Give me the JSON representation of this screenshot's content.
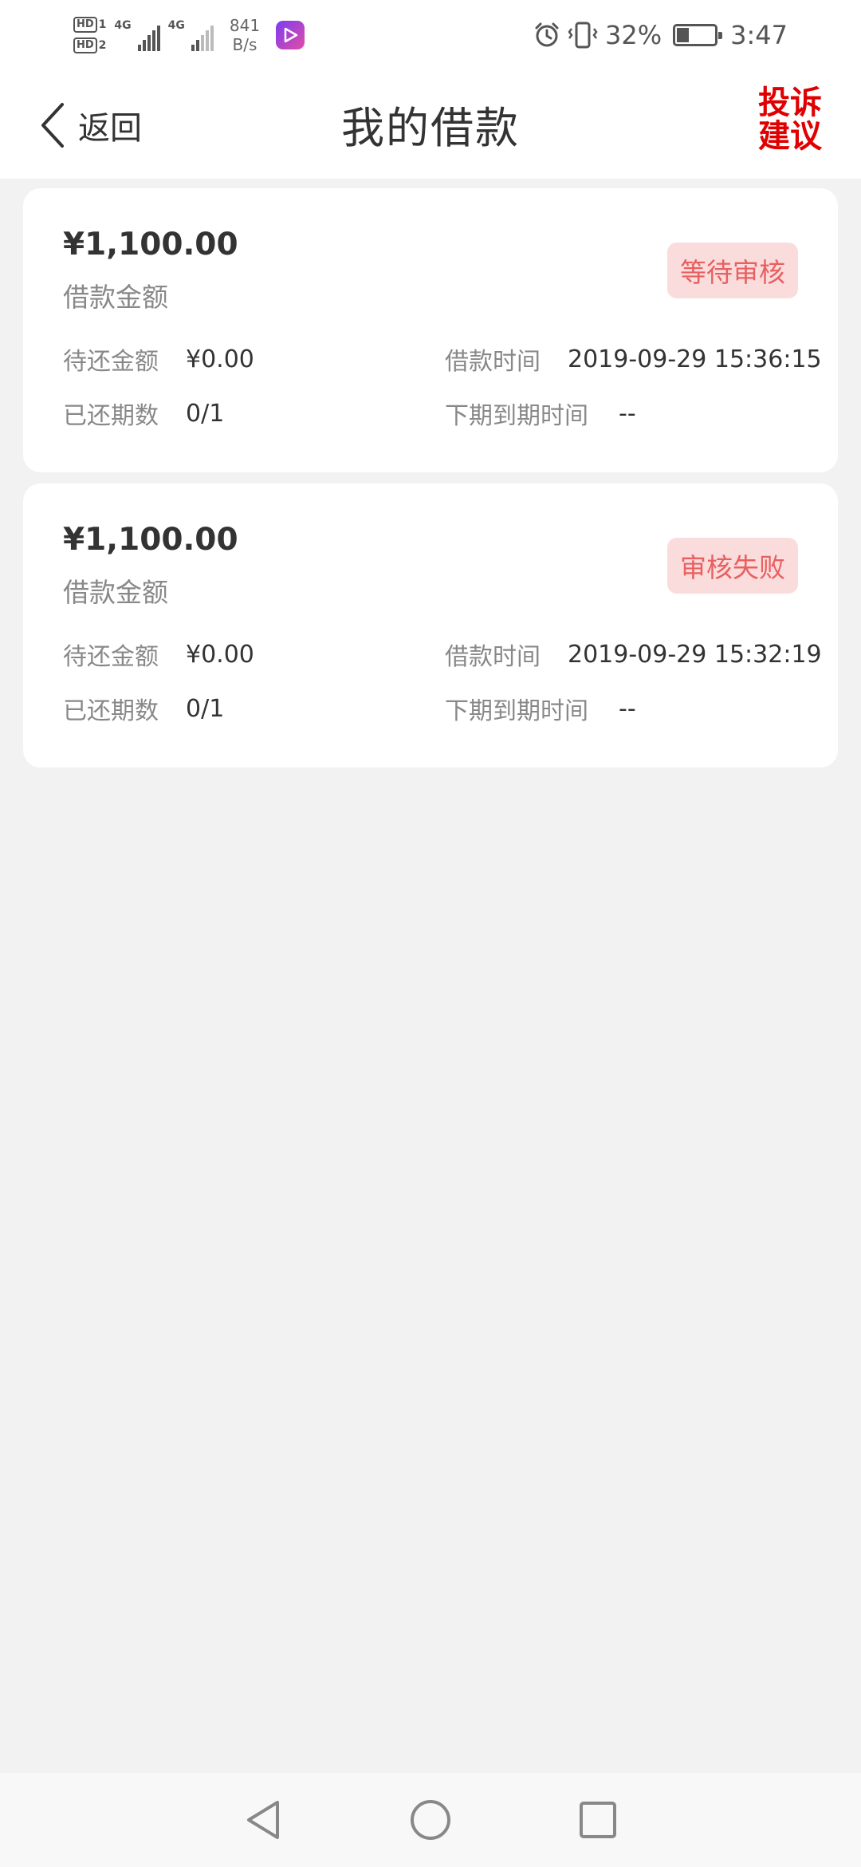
{
  "status_bar": {
    "sim1": "HD",
    "sim1_index": "1",
    "sim2": "HD",
    "sim2_index": "2",
    "network1": "4G",
    "network2": "4G",
    "speed_value": "841",
    "speed_unit": "B/s",
    "battery": "32%",
    "battery_level": 0.32,
    "time": "3:47",
    "icons": [
      "alarm-icon",
      "vibrate-icon",
      "battery-charging-icon",
      "video-app-icon"
    ]
  },
  "nav": {
    "back_label": "返回",
    "title": "我的借款",
    "complaint_line1": "投诉",
    "complaint_line2": "建议"
  },
  "loans": [
    {
      "amount": "¥1,100.00",
      "amount_label": "借款金额",
      "status": "等待审核",
      "pending_label": "待还金额",
      "pending_value": "¥0.00",
      "loan_time_label": "借款时间",
      "loan_time_value": "2019-09-29 15:36:15",
      "periods_label": "已还期数",
      "periods_value": "0/1",
      "next_due_label": "下期到期时间",
      "next_due_value": "--"
    },
    {
      "amount": "¥1,100.00",
      "amount_label": "借款金额",
      "status": "审核失败",
      "pending_label": "待还金额",
      "pending_value": "¥0.00",
      "loan_time_label": "借款时间",
      "loan_time_value": "2019-09-29 15:32:19",
      "periods_label": "已还期数",
      "periods_value": "0/1",
      "next_due_label": "下期到期时间",
      "next_due_value": "--"
    }
  ],
  "colors": {
    "accent_red": "#e00000",
    "badge_bg": "#fbdcdc",
    "badge_text": "#e86060",
    "page_bg": "#f2f2f2"
  }
}
